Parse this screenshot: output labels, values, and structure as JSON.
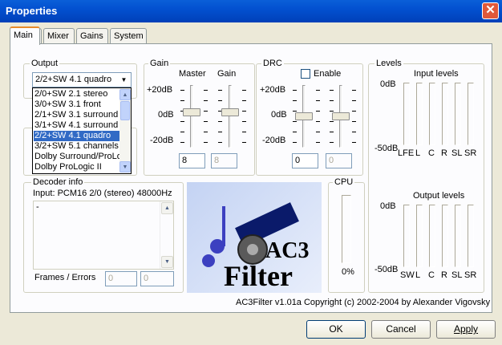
{
  "window": {
    "title": "Properties",
    "close_label": "✕"
  },
  "tabs": [
    {
      "label": "Main"
    },
    {
      "label": "Mixer"
    },
    {
      "label": "Gains"
    },
    {
      "label": "System"
    }
  ],
  "output": {
    "label": "Output",
    "selected": "2/2+SW 4.1 quadro",
    "options": [
      "2/0+SW 2.1 stereo",
      "3/0+SW 3.1 front",
      "2/1+SW 3.1 surround",
      "3/1+SW 4.1 surround",
      "2/2+SW 4.1 quadro",
      "3/2+SW 5.1 channels",
      "Dolby Surround/ProLogic",
      "Dolby ProLogic II"
    ]
  },
  "gain": {
    "label": "Gain",
    "master_label": "Master",
    "gain_label": "Gain",
    "plus_db": "+20dB",
    "zero_db": "0dB",
    "minus_db": "-20dB",
    "master_value": "8",
    "gain_value": "8",
    "master_level": 0.58,
    "gain_level": 0.58
  },
  "drc": {
    "label": "DRC",
    "enable_label": "Enable",
    "plus_db": "+20dB",
    "zero_db": "0dB",
    "minus_db": "-20dB",
    "value1": "0",
    "value2": "0",
    "level1": 0.5,
    "level2": 0.5
  },
  "levels": {
    "label": "Levels",
    "input_title": "Input levels",
    "output_title": "Output levels",
    "top_db": "0dB",
    "bottom_db": "-50dB",
    "input_channels": [
      "LFE",
      "L",
      "C",
      "R",
      "SL",
      "SR"
    ],
    "output_channels": [
      "SW",
      "L",
      "C",
      "R",
      "SL",
      "SR"
    ]
  },
  "decoder": {
    "label": "Decoder info",
    "input_text": "Input: PCM16 2/0 (stereo) 48000Hz",
    "info_text": "-",
    "frames_label": "Frames / Errors",
    "frames": "0",
    "errors": "0"
  },
  "cpu": {
    "label": "CPU",
    "percent": "0%",
    "level": 0
  },
  "logo": {
    "text_ac3": "AC3",
    "text_filter": "Filter"
  },
  "copyright": "AC3Filter v1.01a Copyright (c) 2002-2004 by Alexander Vigovsky",
  "buttons": {
    "ok": "OK",
    "cancel": "Cancel",
    "apply": "Apply"
  },
  "colors": {
    "title_bar": "#0350d0",
    "selection": "#316ac5",
    "tab_accent": "#e68b2c"
  }
}
